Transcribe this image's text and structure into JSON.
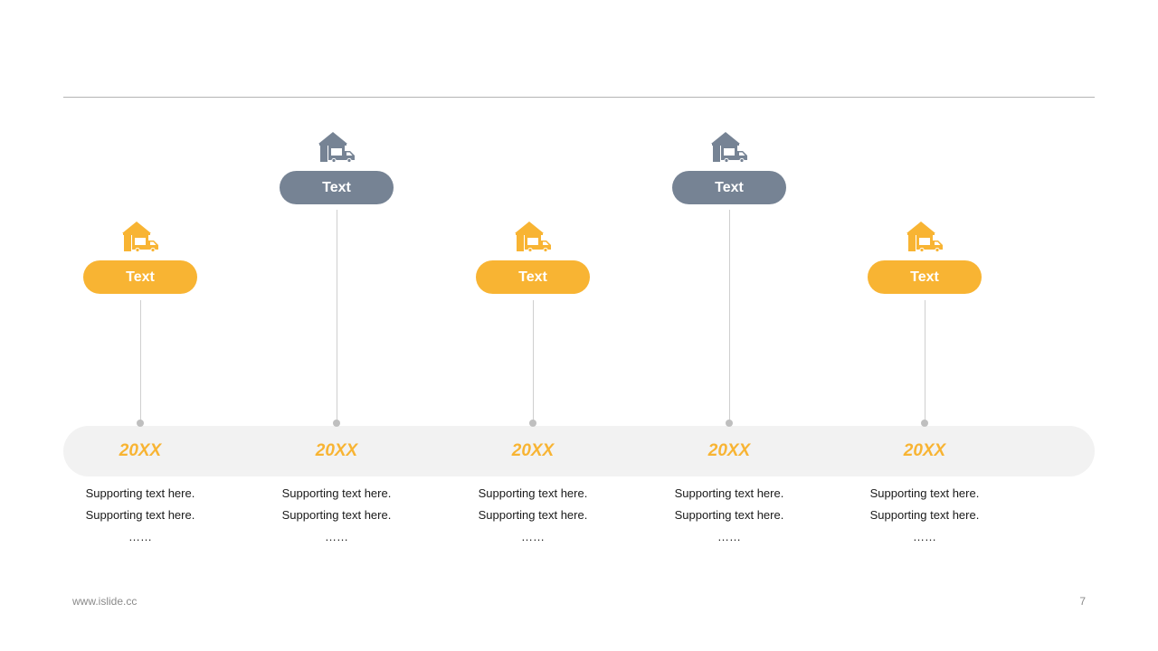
{
  "colors": {
    "accent": "#F8B433",
    "secondary": "#768394",
    "band": "#F2F2F2",
    "rule": "#B4B4B4"
  },
  "timeline": {
    "items": [
      {
        "label": "Text",
        "year": "20XX",
        "line1": "Supporting text here.",
        "line2": "Supporting text here.",
        "ellipsis": "……",
        "icon": "warehouse-truck-icon",
        "color": "accent"
      },
      {
        "label": "Text",
        "year": "20XX",
        "line1": "Supporting text here.",
        "line2": "Supporting text here.",
        "ellipsis": "……",
        "icon": "warehouse-truck-icon",
        "color": "secondary"
      },
      {
        "label": "Text",
        "year": "20XX",
        "line1": "Supporting text here.",
        "line2": "Supporting text here.",
        "ellipsis": "……",
        "icon": "warehouse-truck-icon",
        "color": "accent"
      },
      {
        "label": "Text",
        "year": "20XX",
        "line1": "Supporting text here.",
        "line2": "Supporting text here.",
        "ellipsis": "……",
        "icon": "warehouse-truck-icon",
        "color": "secondary"
      },
      {
        "label": "Text",
        "year": "20XX",
        "line1": "Supporting text here.",
        "line2": "Supporting text here.",
        "ellipsis": "……",
        "icon": "warehouse-truck-icon",
        "color": "accent"
      }
    ]
  },
  "footer": {
    "website": "www.islide.cc",
    "page_number": "7"
  }
}
